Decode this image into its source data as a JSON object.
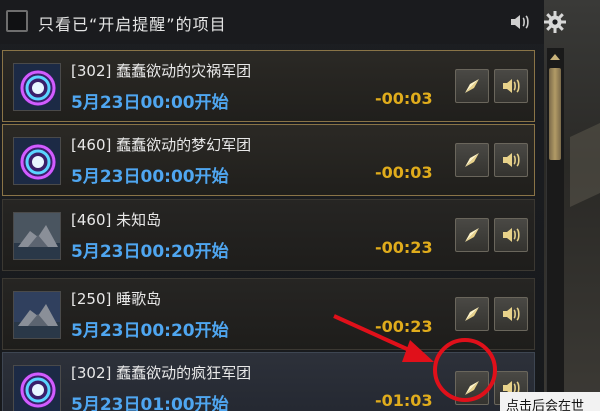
{
  "header": {
    "filter_label": "只看已“开启提醒”的项目",
    "speaker_icon": "speaker-icon",
    "settings_icon": "gear-icon"
  },
  "events": [
    {
      "name": "[302] 蠢蠢欲动的灾祸军团",
      "start": "5月23日00:00开始",
      "countdown": "-00:03",
      "thumb": "portal-icon",
      "highlight": "gold"
    },
    {
      "name": "[460] 蠢蠢欲动的梦幻军团",
      "start": "5月23日00:00开始",
      "countdown": "-00:03",
      "thumb": "portal-icon",
      "highlight": "gold"
    },
    {
      "name": "[460] 未知岛",
      "start": "5月23日00:20开始",
      "countdown": "-00:23",
      "thumb": "island-icon",
      "highlight": "none"
    },
    {
      "name": "[250] 睡歌岛",
      "start": "5月23日00:20开始",
      "countdown": "-00:23",
      "thumb": "island-icon",
      "highlight": "none"
    },
    {
      "name": "[302] 蠢蠢欲动的疯狂军团",
      "start": "5月23日01:00开始",
      "countdown": "-01:03",
      "thumb": "portal-icon",
      "highlight": "selected"
    }
  ],
  "buttons": {
    "navigate_icon": "compass-icon",
    "alarm_icon": "alarm-icon"
  },
  "tooltip": {
    "text": "点击后会在世"
  },
  "colors": {
    "time": "#4fa6f0",
    "countdown": "#e0ac1c",
    "highlight_border": "#8a7447",
    "annotation": "#e0101a"
  }
}
